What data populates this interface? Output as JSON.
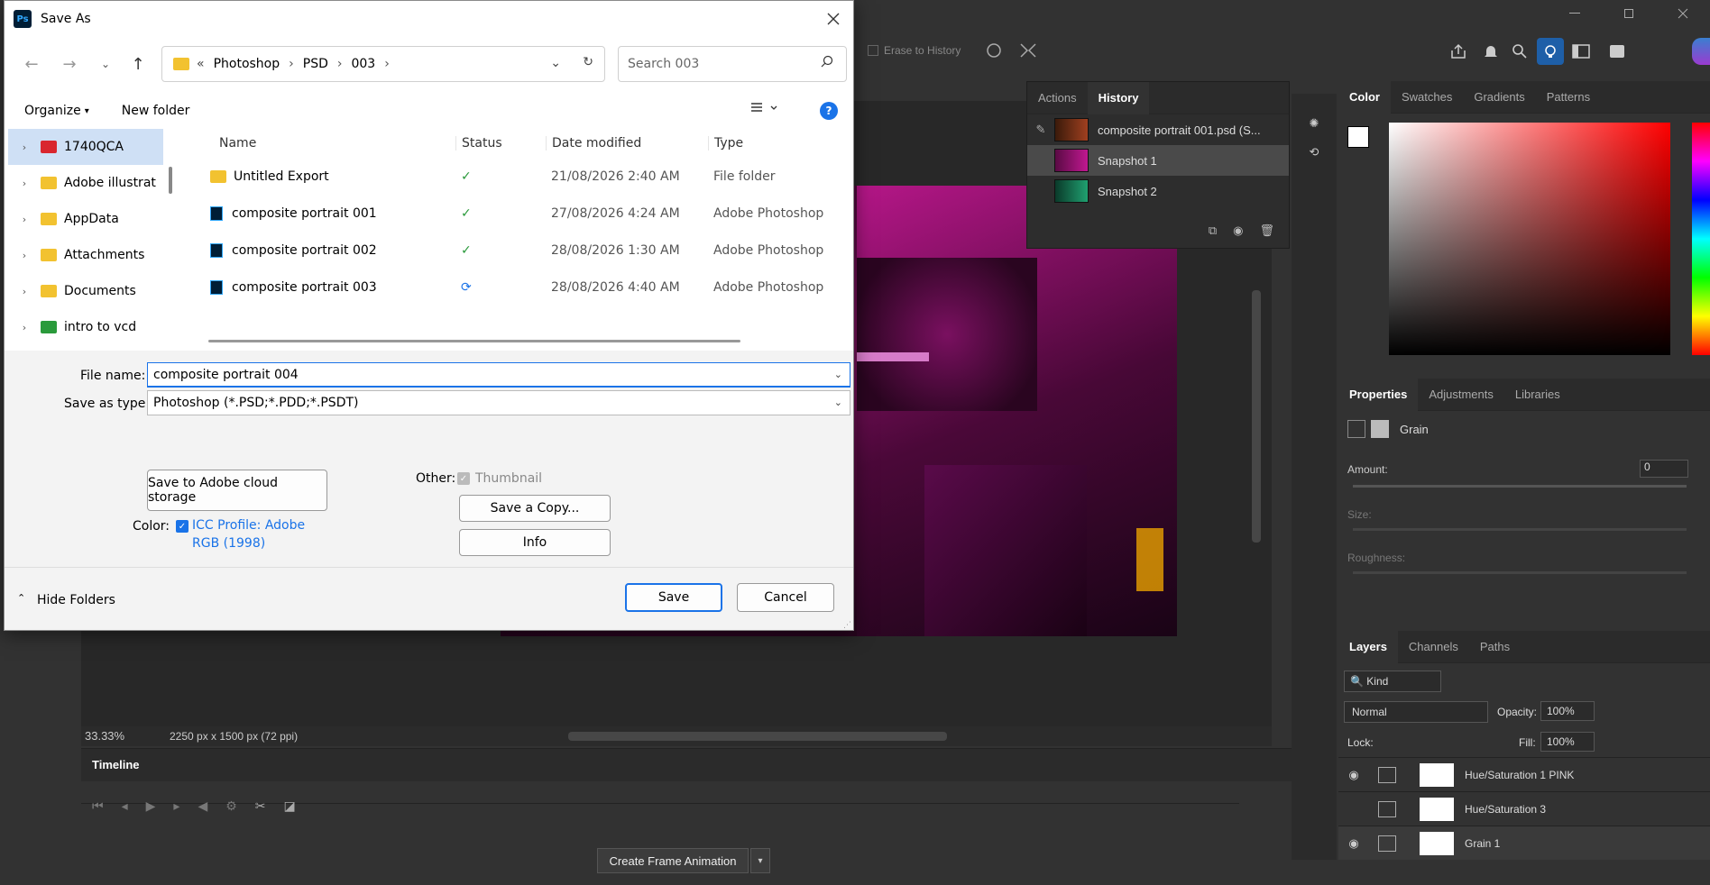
{
  "dialog": {
    "title": "Save As",
    "address": {
      "segments": [
        "Photoshop",
        "PSD",
        "003"
      ],
      "overflow": "«"
    },
    "search_placeholder": "Search 003",
    "organize_label": "Organize",
    "new_folder_label": "New folder",
    "nav_items": [
      {
        "label": "1740QCA",
        "color": "#d9262e"
      },
      {
        "label": "Adobe illustrat",
        "color": "#f2c230"
      },
      {
        "label": "AppData",
        "color": "#f2c230"
      },
      {
        "label": "Attachments",
        "color": "#f2c230"
      },
      {
        "label": "Documents",
        "color": "#f2c230"
      },
      {
        "label": "intro to vcd",
        "color": "#2a9a3b"
      }
    ],
    "columns": {
      "name": "Name",
      "status": "Status",
      "date": "Date modified",
      "type": "Type"
    },
    "files": [
      {
        "name": "Untitled Export",
        "icon": "folder-icon",
        "status": "synced",
        "date": "21/08/2026 2:40 AM",
        "type": "File folder"
      },
      {
        "name": "composite portrait 001",
        "icon": "psd-icon",
        "status": "synced",
        "date": "27/08/2026 4:24 AM",
        "type": "Adobe Photoshop"
      },
      {
        "name": "composite portrait 002",
        "icon": "psd-icon",
        "status": "synced",
        "date": "28/08/2026 1:30 AM",
        "type": "Adobe Photoshop"
      },
      {
        "name": "composite portrait 003",
        "icon": "psd-icon",
        "status": "syncing",
        "date": "28/08/2026 4:40 AM",
        "type": "Adobe Photoshop"
      }
    ],
    "file_name_label": "File name:",
    "file_name_value": "composite portrait 004",
    "save_type_label": "Save as type:",
    "save_type_value": "Photoshop (*.PSD;*.PDD;*.PSDT)",
    "cloud_button": "Save to Adobe cloud storage",
    "color_label": "Color:",
    "icc_line1": "ICC Profile:  Adobe",
    "icc_line2": "RGB (1998)",
    "other_label": "Other:",
    "thumbnail_label": "Thumbnail",
    "save_copy_button": "Save a Copy...",
    "info_button": "Info",
    "hide_folders": "Hide Folders",
    "save_button": "Save",
    "cancel_button": "Cancel"
  },
  "ps": {
    "erase_to_history": "Erase to History",
    "history_tabs": [
      "Actions",
      "History"
    ],
    "history_items": [
      "composite portrait 001.psd (S...",
      "Snapshot 1",
      "Snapshot 2"
    ],
    "color_tabs": [
      "Color",
      "Swatches",
      "Gradients",
      "Patterns"
    ],
    "properties_tabs": [
      "Properties",
      "Adjustments",
      "Libraries"
    ],
    "properties_title": "Grain",
    "amount_label": "Amount:",
    "amount_value": "0",
    "size_label": "Size:",
    "roughness_label": "Roughness:",
    "layers_tabs": [
      "Layers",
      "Channels",
      "Paths"
    ],
    "kind_label": "Kind",
    "blend_mode": "Normal",
    "opacity_label": "Opacity:",
    "opacity_value": "100%",
    "lock_label": "Lock:",
    "fill_label": "Fill:",
    "fill_value": "100%",
    "layers": [
      "Hue/Saturation 1 PINK",
      "Hue/Saturation 3",
      "Grain 1"
    ],
    "zoom": "33.33%",
    "doc_info": "2250 px x 1500 px (72 ppi)",
    "timeline_label": "Timeline",
    "create_frame_animation": "Create Frame Animation"
  }
}
